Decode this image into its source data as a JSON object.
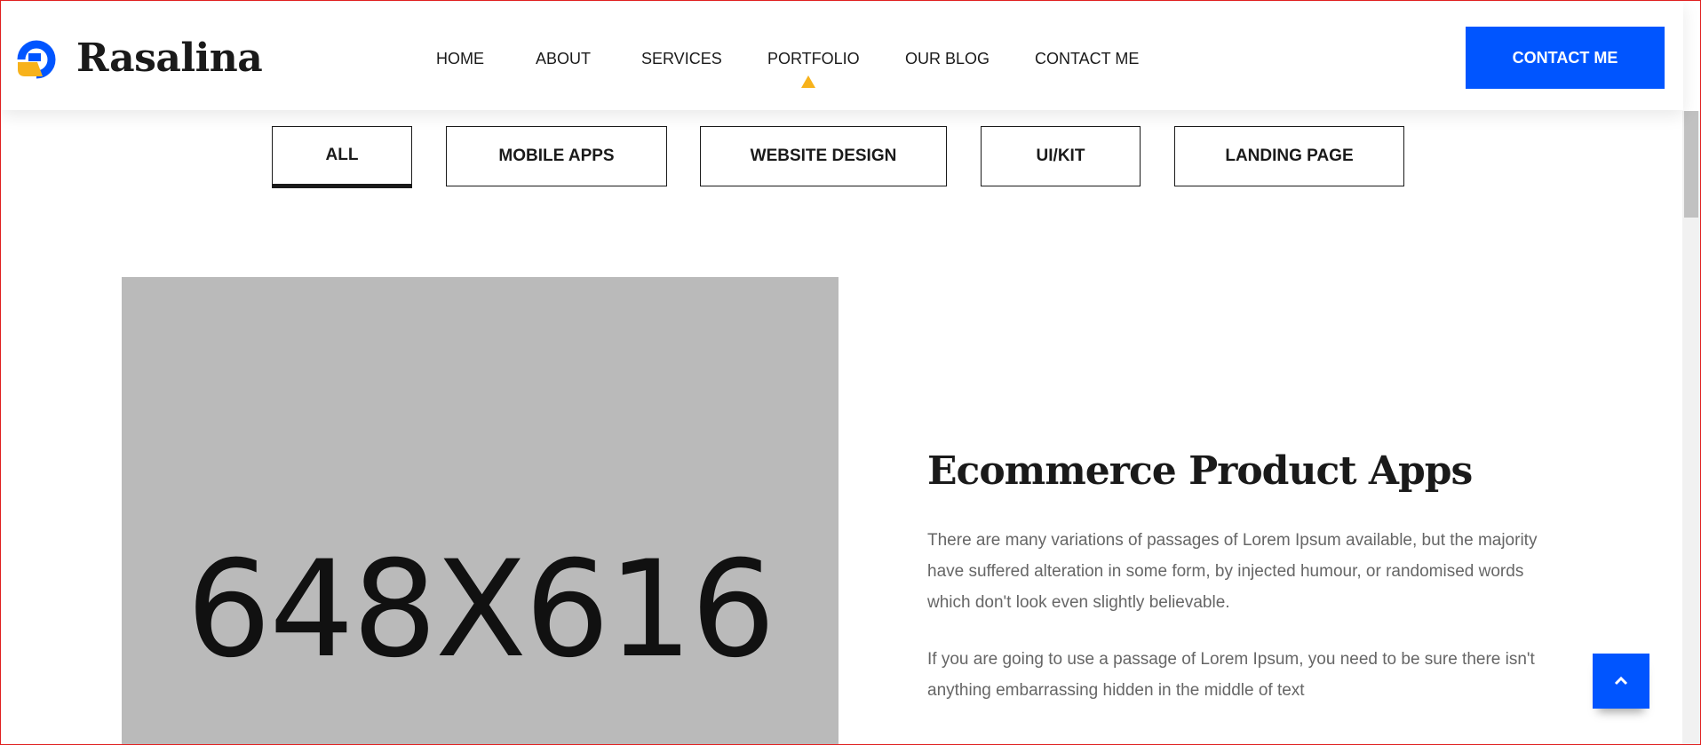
{
  "brand": {
    "name": "Rasalina",
    "logo_icon": "rasalina-r-logo-icon",
    "logo_colors": [
      "#0055ff",
      "#f7b21b"
    ]
  },
  "nav": {
    "items": [
      {
        "label": "HOME"
      },
      {
        "label": "ABOUT"
      },
      {
        "label": "SERVICES"
      },
      {
        "label": "PORTFOLIO",
        "active": true
      },
      {
        "label": "OUR BLOG"
      },
      {
        "label": "CONTACT ME"
      }
    ],
    "active_indicator_color": "#f7b21b",
    "cta_label": "CONTACT ME",
    "cta_color": "#0055ff"
  },
  "filters": {
    "tabs": [
      {
        "label": "ALL",
        "active": true
      },
      {
        "label": "MOBILE APPS"
      },
      {
        "label": "WEBSITE DESIGN"
      },
      {
        "label": "UI/KIT"
      },
      {
        "label": "LANDING PAGE"
      }
    ]
  },
  "portfolio_item": {
    "image_placeholder_text": "648X616",
    "title": "Ecommerce Product Apps",
    "paragraphs": [
      "There are many variations of passages of Lorem Ipsum available, but the majority have suffered alteration in some form, by injected humour, or randomised words which don't look even slightly believable.",
      "If you are going to use a passage of Lorem Ipsum, you need to be sure there isn't anything embarrassing hidden in the middle of text"
    ]
  },
  "back_to_top": {
    "icon": "chevron-up-icon",
    "color": "#0055ff"
  }
}
